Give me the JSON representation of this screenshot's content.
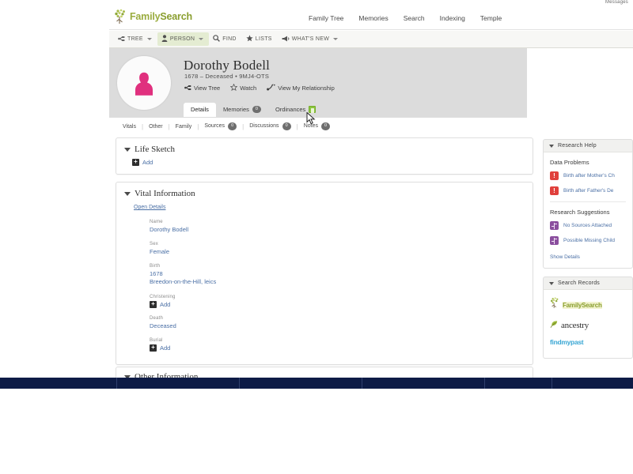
{
  "browser": {
    "messages_label": "Messages"
  },
  "masthead": {
    "brand": "FamilySearch",
    "brand_part1": "Family",
    "brand_part2": "Search",
    "nav": [
      {
        "label": "Family Tree",
        "name": "nav-family-tree"
      },
      {
        "label": "Memories",
        "name": "nav-memories"
      },
      {
        "label": "Search",
        "name": "nav-search"
      },
      {
        "label": "Indexing",
        "name": "nav-indexing"
      },
      {
        "label": "Temple",
        "name": "nav-temple"
      }
    ]
  },
  "utilbar": {
    "items": [
      {
        "label": "TREE",
        "icon": "tree-icon",
        "caret": true,
        "active": false
      },
      {
        "label": "PERSON",
        "icon": "person-icon",
        "caret": true,
        "active": true
      },
      {
        "label": "FIND",
        "icon": "search-icon",
        "caret": false,
        "active": false
      },
      {
        "label": "LISTS",
        "icon": "star-icon",
        "caret": false,
        "active": false
      },
      {
        "label": "WHAT'S NEW",
        "icon": "megaphone-icon",
        "caret": true,
        "active": false
      }
    ]
  },
  "person": {
    "name": "Dorothy Bodell",
    "meta": "1678 – Deceased • 9MJ4-OTS",
    "avatar_icon": "female-silhouette-icon",
    "actions": [
      {
        "label": "View Tree",
        "icon": "tree-icon"
      },
      {
        "label": "Watch",
        "icon": "star-outline-icon"
      },
      {
        "label": "View My Relationship",
        "icon": "relationship-icon"
      }
    ]
  },
  "tabs": [
    {
      "label": "Details",
      "active": true,
      "badge": null,
      "icon": null
    },
    {
      "label": "Memories",
      "active": false,
      "badge": "0",
      "icon": null
    },
    {
      "label": "Ordinances",
      "active": false,
      "badge": null,
      "icon": "ordinance-green-icon"
    }
  ],
  "subnav": [
    {
      "label": "Vitals",
      "badge": null
    },
    {
      "label": "Other",
      "badge": null
    },
    {
      "label": "Family",
      "badge": null
    },
    {
      "label": "Sources",
      "badge": "0"
    },
    {
      "label": "Discussions",
      "badge": "0"
    },
    {
      "label": "Notes",
      "badge": "0"
    }
  ],
  "life_sketch": {
    "title": "Life Sketch",
    "add_label": "Add"
  },
  "vital_information": {
    "title": "Vital Information",
    "open_details_label": "Open Details",
    "rows": [
      {
        "label": "Name",
        "values": [
          "Dorothy Bodell"
        ],
        "add": false
      },
      {
        "label": "Sex",
        "values": [
          "Female"
        ],
        "add": false
      },
      {
        "label": "Birth",
        "values": [
          "1678",
          "Breedon-on-the-Hill, leics"
        ],
        "add": false
      },
      {
        "label": "Christening",
        "values": [],
        "add": true,
        "add_label": "Add"
      },
      {
        "label": "Death",
        "values": [
          "Deceased"
        ],
        "add": false
      },
      {
        "label": "Burial",
        "values": [],
        "add": true,
        "add_label": "Add"
      }
    ]
  },
  "other_information": {
    "title": "Other Information"
  },
  "research_help": {
    "title": "Research Help",
    "data_problems_title": "Data Problems",
    "data_problems": [
      {
        "label": "Birth after Mother's Ch",
        "icon": "alert-icon"
      },
      {
        "label": "Birth after Father's De",
        "icon": "alert-icon"
      }
    ],
    "suggestions_title": "Research Suggestions",
    "suggestions": [
      {
        "label": "No Sources Attached",
        "icon": "suggestion-icon"
      },
      {
        "label": "Possible Missing Child",
        "icon": "suggestion-icon"
      }
    ],
    "show_details_label": "Show Details"
  },
  "search_records": {
    "title": "Search Records",
    "providers": [
      {
        "label": "FamilySearch",
        "name": "familysearch-logo"
      },
      {
        "label": "ancestry",
        "name": "ancestry-logo"
      },
      {
        "label": "findmypast",
        "name": "findmypast-logo"
      }
    ]
  },
  "colors": {
    "brand_green": "#8a9e2f",
    "accent_link": "#4a6fa5",
    "alert_red": "#e0403c",
    "suggestion_purple": "#8b4f9e",
    "ordinance_green": "#8cc63e",
    "avatar_pink": "#e0307e",
    "taskbar_navy": "#0d1b46",
    "banner_gray": "#dcdcdc"
  }
}
